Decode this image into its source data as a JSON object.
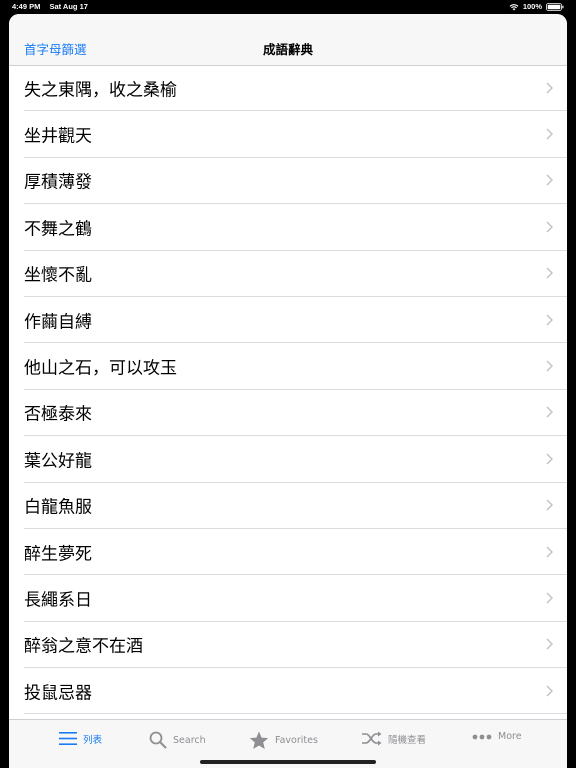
{
  "status": {
    "time": "4:49 PM",
    "date": "Sat Aug 17",
    "battery": "100%"
  },
  "nav": {
    "left_button": "首字母篩選",
    "title": "成語辭典"
  },
  "list": {
    "items": [
      "失之東隅，收之桑榆",
      "坐井觀天",
      "厚積薄發",
      "不舞之鶴",
      "坐懷不亂",
      "作繭自縛",
      "他山之石，可以攻玉",
      "否極泰來",
      "葉公好龍",
      "白龍魚服",
      "醉生夢死",
      "長繩系日",
      "醉翁之意不在酒",
      "投鼠忌器"
    ]
  },
  "tabs": [
    {
      "label": "列表",
      "icon": "list-icon",
      "active": true
    },
    {
      "label": "Search",
      "icon": "search-icon",
      "active": false
    },
    {
      "label": "Favorites",
      "icon": "star-icon",
      "active": false
    },
    {
      "label": "隨機查看",
      "icon": "shuffle-icon",
      "active": false
    },
    {
      "label": "More",
      "icon": "more-icon",
      "active": false
    }
  ],
  "colors": {
    "accent": "#1a7cf5",
    "inactive": "#8e8e93"
  }
}
